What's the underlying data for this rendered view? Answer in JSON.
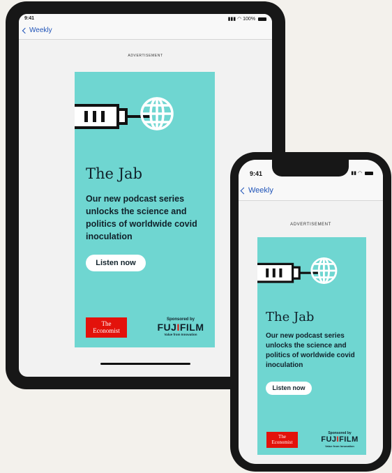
{
  "status": {
    "time": "9:41",
    "tablet_battery": "100%"
  },
  "nav": {
    "back_label": "Weekly"
  },
  "ad": {
    "label": "ADVERTISEMENT",
    "title": "The Jab",
    "body": "Our new podcast series unlocks the science and politics of worldwide covid inoculation",
    "cta": "Listen now",
    "publisher_line1": "The",
    "publisher_line2": "Economist",
    "sponsored_by": "Sponsored by",
    "sponsor_a": "FUJ",
    "sponsor_b": "I",
    "sponsor_c": "FILM",
    "sponsor_tagline": "Value from Innovation",
    "background": "#6fd6d1",
    "publisher_color": "#e3120b"
  },
  "icons": [
    "chevron-left-icon",
    "signal-icon",
    "wifi-icon",
    "battery-icon",
    "syringe-icon",
    "globe-icon"
  ]
}
